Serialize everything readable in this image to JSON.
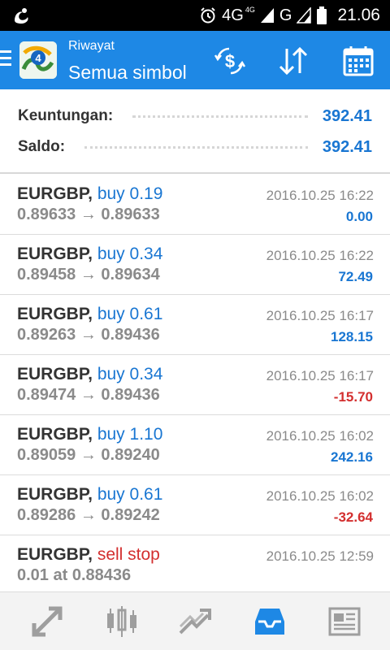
{
  "status_bar": {
    "network": "4G",
    "network_small": "4G",
    "carrier": "G",
    "time": "21.06"
  },
  "header": {
    "title": "Riwayat",
    "subtitle": "Semua simbol",
    "icons": [
      "menu-icon",
      "metatrader-logo-icon",
      "currency-exchange-icon",
      "sort-icon",
      "calendar-icon"
    ]
  },
  "summary": {
    "profit_label": "Keuntungan:",
    "profit_value": "392.41",
    "balance_label": "Saldo:",
    "balance_value": "392.41"
  },
  "trades": [
    {
      "symbol": "EURGBP,",
      "type": "buy 0.19",
      "prices": "0.89633 → 0.89633",
      "time": "2016.10.25 16:22",
      "profit": "0.00"
    },
    {
      "symbol": "EURGBP,",
      "type": "buy 0.34",
      "prices": "0.89458 → 0.89634",
      "time": "2016.10.25 16:22",
      "profit": "72.49"
    },
    {
      "symbol": "EURGBP,",
      "type": "buy 0.61",
      "prices": "0.89263 → 0.89436",
      "time": "2016.10.25 16:17",
      "profit": "128.15"
    },
    {
      "symbol": "EURGBP,",
      "type": "buy 0.34",
      "prices": "0.89474 → 0.89436",
      "time": "2016.10.25 16:17",
      "profit": "-15.70"
    },
    {
      "symbol": "EURGBP,",
      "type": "buy 1.10",
      "prices": "0.89059 → 0.89240",
      "time": "2016.10.25 16:02",
      "profit": "242.16"
    },
    {
      "symbol": "EURGBP,",
      "type": "buy 0.61",
      "prices": "0.89286 → 0.89242",
      "time": "2016.10.25 16:02",
      "profit": "-32.64"
    },
    {
      "symbol": "EURGBP,",
      "type": "sell stop",
      "prices": "0.01 at 0.88436",
      "time": "2016.10.25 12:59",
      "profit": ""
    }
  ],
  "bottom_nav": {
    "items": [
      "quotes-icon",
      "chart-icon",
      "trade-icon",
      "history-icon",
      "news-icon"
    ],
    "active": "history-icon"
  },
  "colors": {
    "header_bg": "#1e88e5",
    "accent_blue": "#1976d2",
    "negative_red": "#d32f2f",
    "muted_gray": "#8a8a8a"
  }
}
